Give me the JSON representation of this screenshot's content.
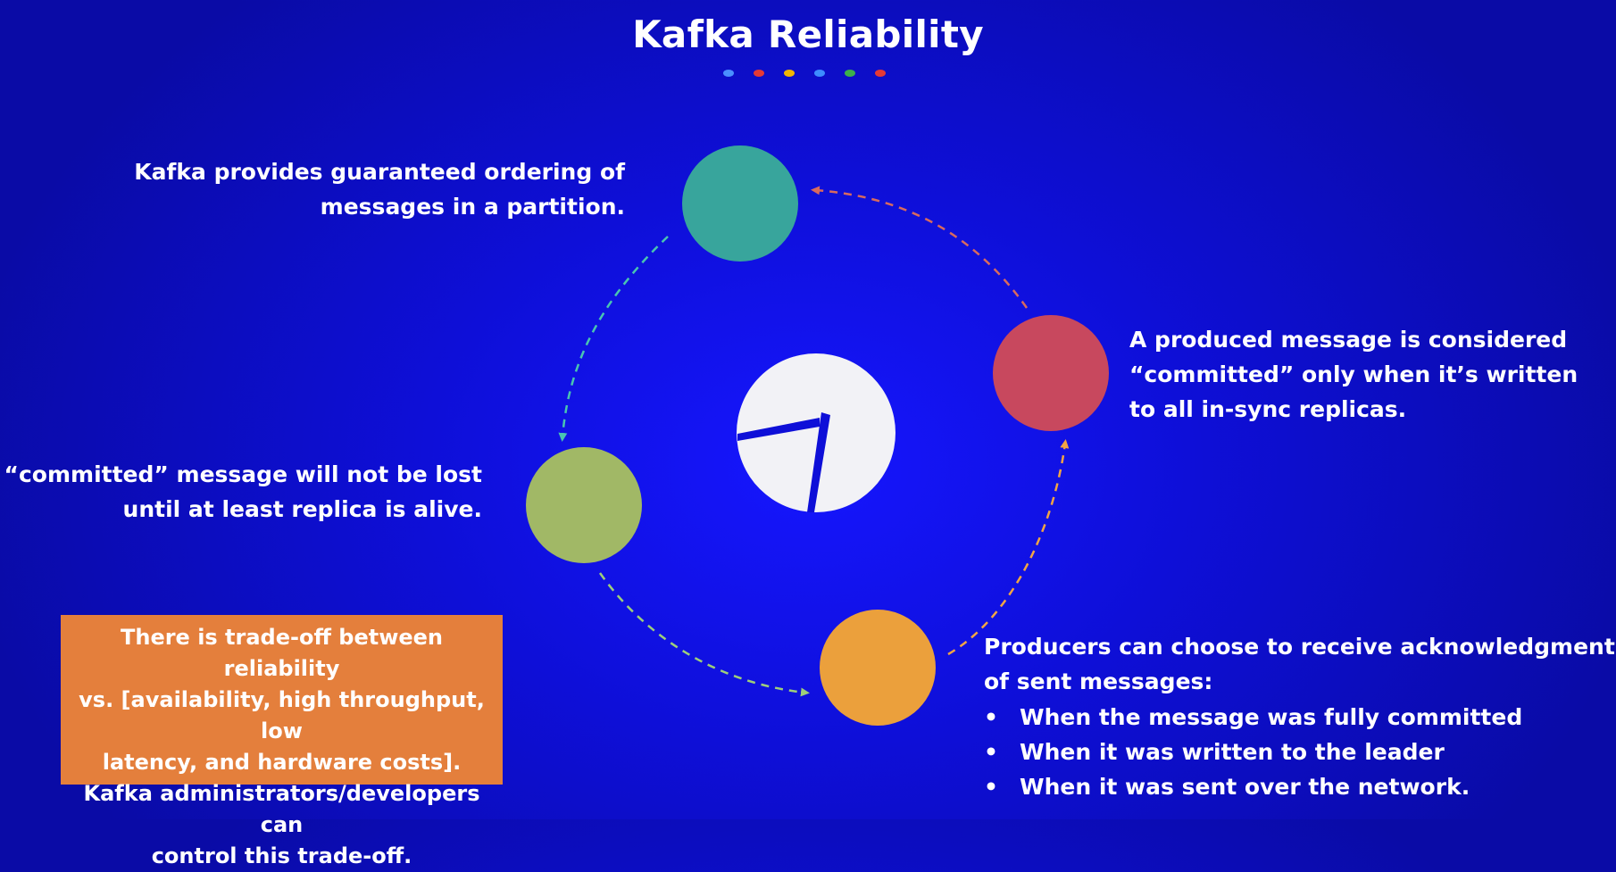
{
  "title": "Kafka Reliability",
  "accent_dots": [
    "#4a8fff",
    "#e53935",
    "#f2b600",
    "#3d8cff",
    "#3cb04a",
    "#e53935"
  ],
  "colors": {
    "background": "#0e0fd8",
    "teal": "#38a59c",
    "red": "#c8485e",
    "green": "#a1b866",
    "orange": "#eba03c",
    "callout": "#e47f3c"
  },
  "nodes": {
    "top": {
      "icon": "teal-circle",
      "text_lines": [
        "Kafka provides guaranteed ordering of",
        "messages in a partition."
      ]
    },
    "right": {
      "icon": "red-circle",
      "text_lines": [
        "A produced message is considered",
        "“committed” only when it’s written",
        "to all in-sync replicas."
      ]
    },
    "left": {
      "icon": "green-circle",
      "text_lines": [
        "A “committed” message will not be lost",
        "until at least replica is alive."
      ]
    },
    "bottom": {
      "icon": "orange-circle",
      "text_lines": [
        "Producers can choose to receive acknowledgments",
        "of sent messages:"
      ],
      "bullets": [
        "When the message was fully committed",
        "When it was written to the leader",
        "When it was sent over the network."
      ]
    }
  },
  "callout": {
    "lines": [
      "There is trade-off between reliability",
      "vs. [availability, high throughput, low",
      "latency, and hardware costs].",
      "Kafka administrators/developers can",
      "control this trade-off."
    ]
  },
  "center_icon": "kafka-logo-icon"
}
